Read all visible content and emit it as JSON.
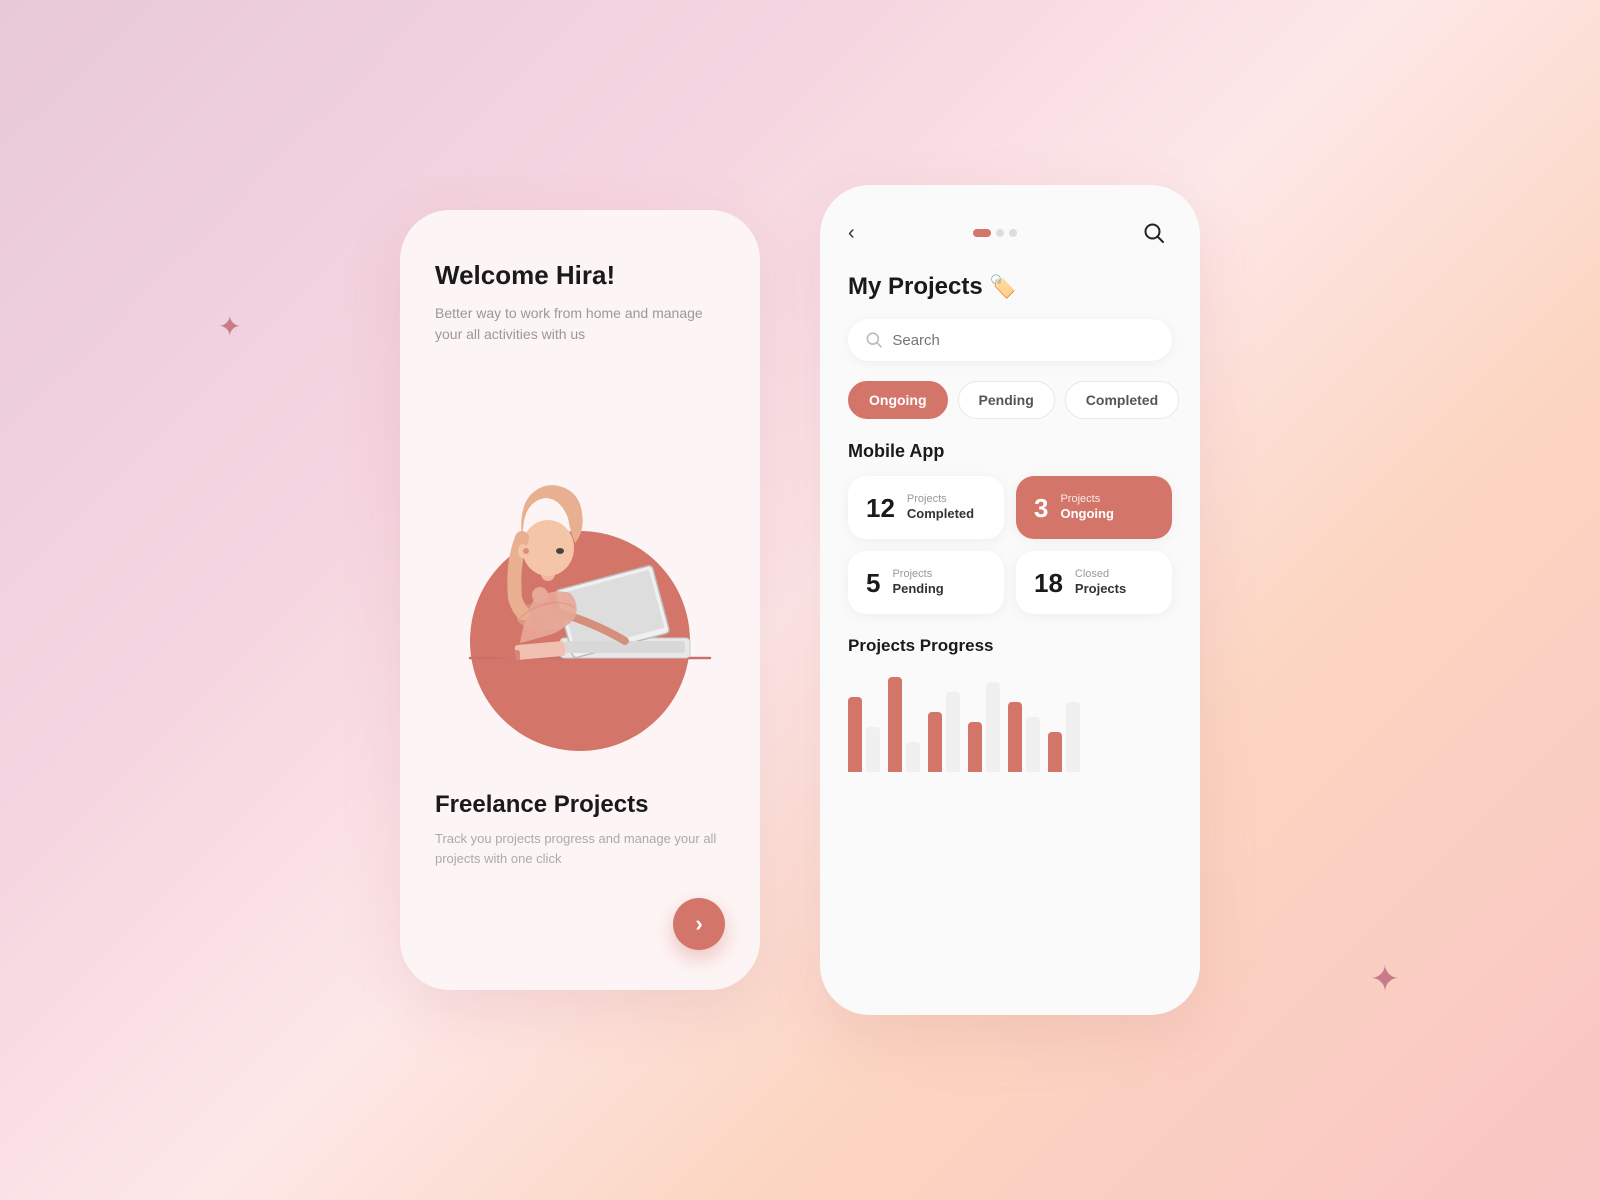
{
  "background": {
    "gradient_start": "#e8c9d8",
    "gradient_end": "#f9c5c5"
  },
  "sparkles": {
    "left": "✦",
    "right": "✦"
  },
  "left_phone": {
    "welcome_title": "Welcome Hira!",
    "welcome_subtitle": "Better way to work from home and manage your all activities with us",
    "freelance_title": "Freelance Projects",
    "freelance_subtitle": "Track you projects progress and manage your all projects with one click",
    "next_button_label": "›"
  },
  "right_phone": {
    "header": {
      "back_label": "‹",
      "dots": [
        "active",
        "inactive",
        "inactive"
      ],
      "search_icon": "⌕"
    },
    "page_title": "My Projects",
    "page_emoji": "🏷️",
    "search": {
      "placeholder": "Search"
    },
    "tabs": [
      {
        "label": "Ongoing",
        "active": true
      },
      {
        "label": "Pending",
        "active": false
      },
      {
        "label": "Completed",
        "active": false
      }
    ],
    "mobile_app_title": "Mobile App",
    "stats": [
      {
        "number": "12",
        "label_top": "Projects",
        "label_bottom": "Completed",
        "accent": false
      },
      {
        "number": "3",
        "label_top": "Projects",
        "label_bottom": "Ongoing",
        "accent": true
      },
      {
        "number": "5",
        "label_top": "Projects",
        "label_bottom": "Pending",
        "accent": false
      },
      {
        "number": "18",
        "label_top": "Closed",
        "label_bottom": "Projects",
        "accent": false
      }
    ],
    "progress_title": "Projects Progress",
    "chart_bars": [
      {
        "pink": 75,
        "light": 45
      },
      {
        "pink": 95,
        "light": 30
      },
      {
        "pink": 60,
        "light": 80
      },
      {
        "pink": 50,
        "light": 90
      },
      {
        "pink": 70,
        "light": 55
      },
      {
        "pink": 40,
        "light": 70
      }
    ]
  }
}
